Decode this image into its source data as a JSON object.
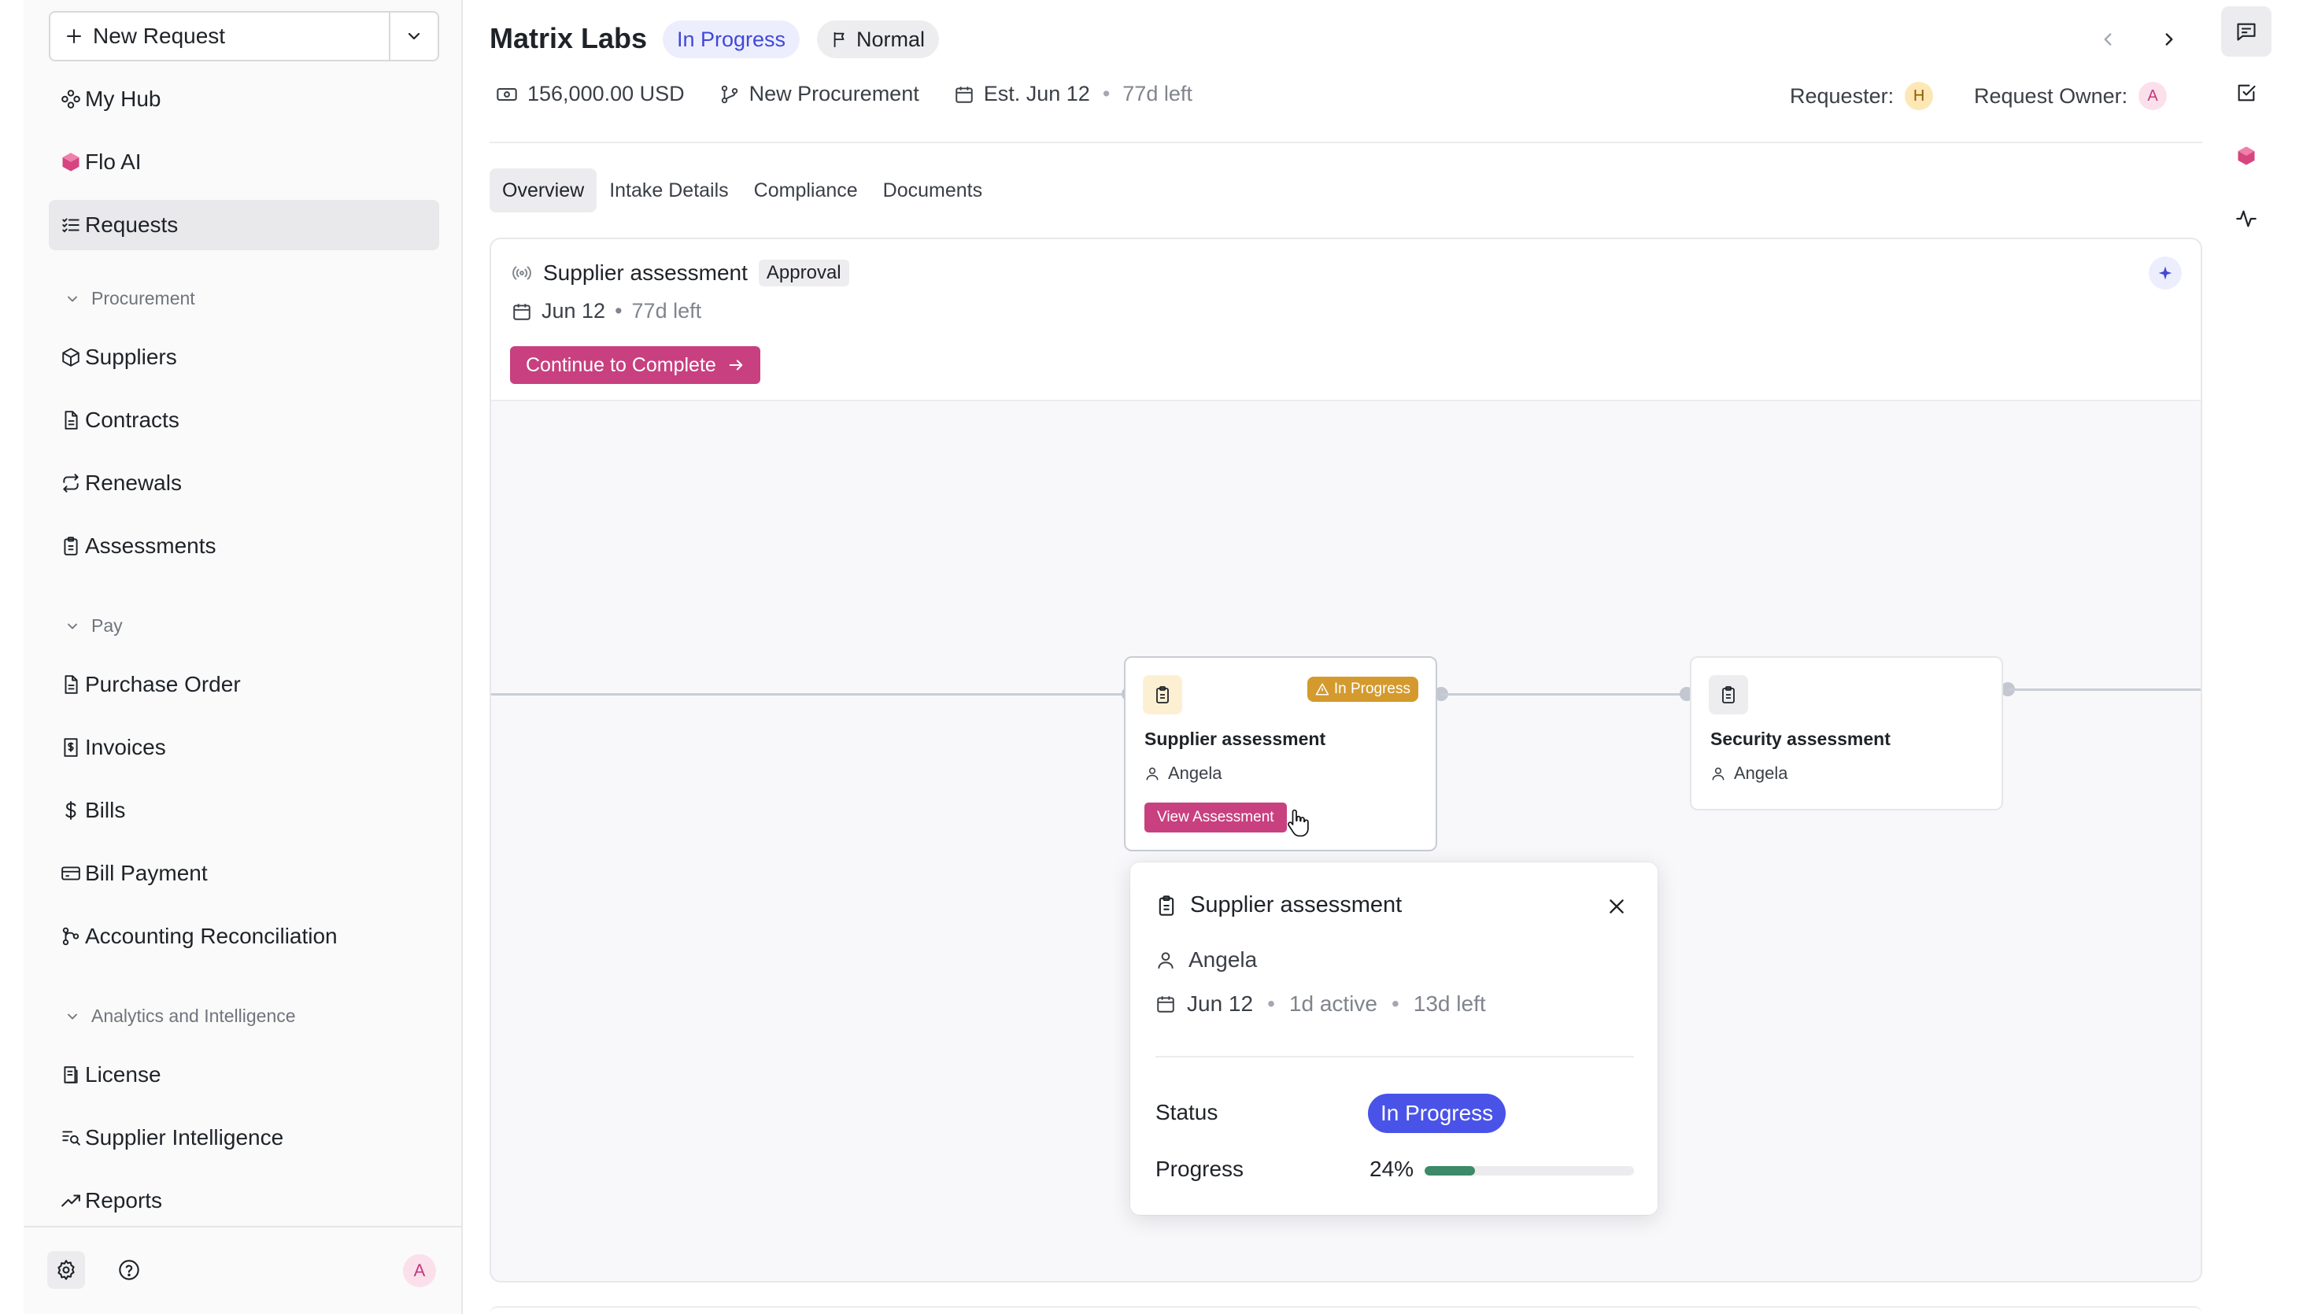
{
  "sidebar": {
    "new_request_label": "New Request",
    "items": [
      {
        "label": "My Hub",
        "icon": "hub-icon"
      },
      {
        "label": "Flo AI",
        "icon": "flo-ai-icon"
      },
      {
        "label": "Requests",
        "icon": "list-icon",
        "active": true
      }
    ],
    "sections": [
      {
        "title": "Procurement",
        "items": [
          {
            "label": "Suppliers",
            "icon": "box-icon"
          },
          {
            "label": "Contracts",
            "icon": "document-icon"
          },
          {
            "label": "Renewals",
            "icon": "repeat-icon"
          },
          {
            "label": "Assessments",
            "icon": "clipboard-icon"
          }
        ]
      },
      {
        "title": "Pay",
        "items": [
          {
            "label": "Purchase Order",
            "icon": "document-icon"
          },
          {
            "label": "Invoices",
            "icon": "receipt-icon"
          },
          {
            "label": "Bills",
            "icon": "dollar-icon"
          },
          {
            "label": "Bill Payment",
            "icon": "credit-card-icon"
          },
          {
            "label": "Accounting Reconciliation",
            "icon": "branch-icon"
          }
        ]
      },
      {
        "title": "Analytics and Intelligence",
        "items": [
          {
            "label": "License",
            "icon": "license-icon"
          },
          {
            "label": "Supplier Intelligence",
            "icon": "search-list-icon"
          },
          {
            "label": "Reports",
            "icon": "trend-icon"
          }
        ]
      }
    ],
    "footer": {
      "avatar_initial": "A"
    }
  },
  "header": {
    "title": "Matrix Labs",
    "status": "In Progress",
    "priority": "Normal",
    "amount": "156,000.00 USD",
    "type": "New Procurement",
    "est_date": "Est. Jun 12",
    "time_left": "77d left",
    "requester_label": "Requester:",
    "requester_initial": "H",
    "owner_label": "Request Owner:",
    "owner_initial": "A"
  },
  "tabs": [
    "Overview",
    "Intake Details",
    "Compliance",
    "Documents"
  ],
  "active_tab": "Overview",
  "step": {
    "title": "Supplier assessment",
    "tag": "Approval",
    "date": "Jun 12",
    "time_left": "77d left",
    "cta_label": "Continue to Complete"
  },
  "flow": {
    "nodes": [
      {
        "title": "Supplier assessment",
        "user": "Angela",
        "badge": "In Progress",
        "button": "View Assessment"
      },
      {
        "title": "Security assessment",
        "user": "Angela"
      }
    ]
  },
  "popover": {
    "title": "Supplier assessment",
    "user": "Angela",
    "date": "Jun 12",
    "active": "1d active",
    "left": "13d left",
    "status_label": "Status",
    "status_value": "In Progress",
    "progress_label": "Progress",
    "progress_text": "24%",
    "progress_fraction": 0.24
  },
  "colors": {
    "accent": "#c8407f",
    "status_blue": "#4953e8",
    "progress_green": "#3c8a68",
    "warning": "#d49a2e"
  }
}
